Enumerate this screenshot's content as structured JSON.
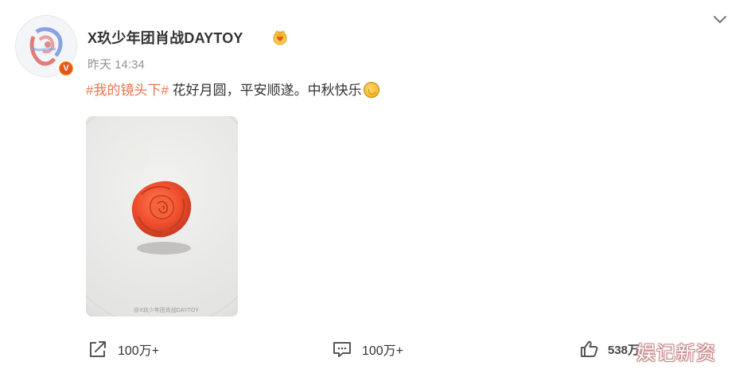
{
  "post": {
    "username": "X玖少年团肖战DAYTOY",
    "time": "昨天 14:34",
    "verified_badge": "V",
    "hashtag": "#我的镜头下#",
    "text": " 花好月圆，平安顺遂。中秋快乐",
    "image_watermark": "@X玖少年团肖战DAYTOY"
  },
  "footer": {
    "share_count": "100万+",
    "comment_count": "100万+",
    "like_count": "538万"
  },
  "watermark": "娱记新资",
  "icons": [
    "crown-icon",
    "chevron-down-icon",
    "moon-emoji-icon",
    "share-icon",
    "comment-icon",
    "like-icon"
  ],
  "colors": {
    "hashtag": "#eb7350",
    "badge": "#f5a623",
    "text": "#333333",
    "meta": "#939393"
  }
}
